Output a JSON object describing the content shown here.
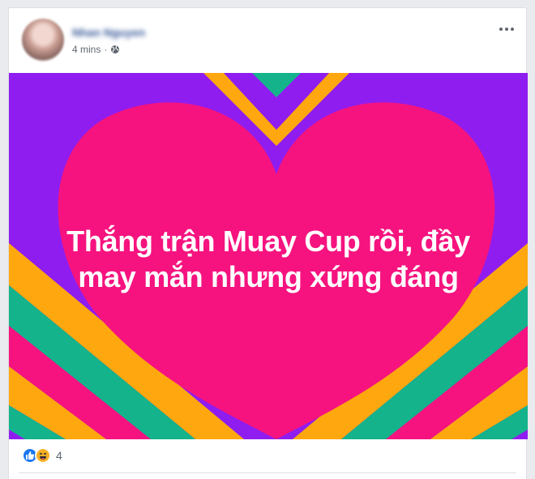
{
  "post": {
    "author": "Nhan Nguyen",
    "timestamp": "4 mins",
    "separator": "·",
    "privacy_icon": "globe-icon",
    "more_icon": "more-options-icon",
    "text_line1": "Thắng trận Muay Cup rồi, đầy",
    "text_line2": "may mắn nhưng xứng đáng",
    "background_colors": {
      "purple": "#8f1df0",
      "pink": "#f6137f",
      "orange": "#ffa70f",
      "green": "#14b38b"
    }
  },
  "reactions": {
    "icons": [
      "like-icon",
      "haha-icon"
    ],
    "count": "4"
  }
}
